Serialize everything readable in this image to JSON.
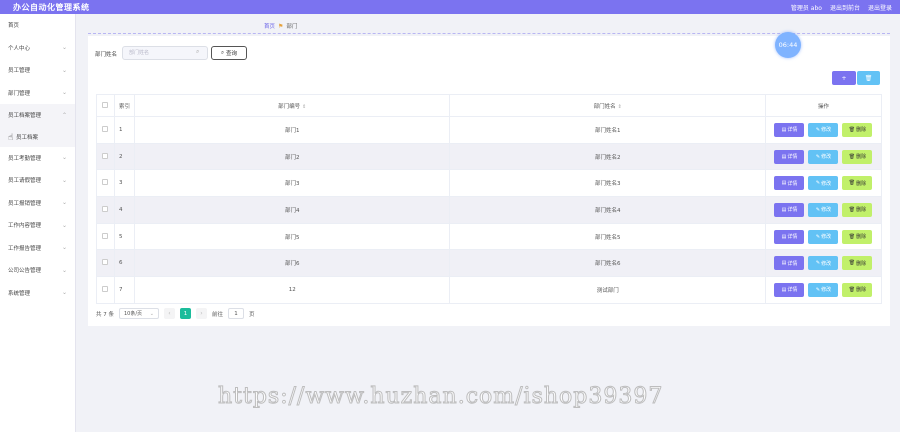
{
  "header": {
    "title": "办公自动化管理系统",
    "links": [
      "管理员 abo",
      "退出到前台",
      "退出登录"
    ]
  },
  "sidebar": {
    "items": [
      {
        "label": "首页",
        "arrow": false
      },
      {
        "label": "个人中心",
        "arrow": true
      },
      {
        "label": "员工管理",
        "arrow": true
      },
      {
        "label": "部门管理",
        "arrow": true
      },
      {
        "label": "员工档案管理",
        "arrow": true,
        "open": true
      },
      {
        "label": "员工档案",
        "arrow": false,
        "sub": true
      },
      {
        "label": "员工考勤管理",
        "arrow": true
      },
      {
        "label": "员工请假管理",
        "arrow": true
      },
      {
        "label": "员工报销管理",
        "arrow": true
      },
      {
        "label": "工作内容管理",
        "arrow": true
      },
      {
        "label": "工作报告管理",
        "arrow": true
      },
      {
        "label": "公司公告管理",
        "arrow": true
      },
      {
        "label": "系统管理",
        "arrow": true
      }
    ]
  },
  "breadcrumb": {
    "home": "首页",
    "current": "部门"
  },
  "search": {
    "label": "部门姓名",
    "placeholder": "部门姓名",
    "button": "查询"
  },
  "clock": "06:44",
  "toolbar": {
    "add": "+",
    "delete": "🗑"
  },
  "table": {
    "headers": {
      "index": "索引",
      "code": "部门编号",
      "name": "部门姓名",
      "ops": "操作"
    },
    "rows": [
      {
        "index": "1",
        "code": "部门1",
        "name": "部门姓名1"
      },
      {
        "index": "2",
        "code": "部门2",
        "name": "部门姓名2"
      },
      {
        "index": "3",
        "code": "部门3",
        "name": "部门姓名3"
      },
      {
        "index": "4",
        "code": "部门4",
        "name": "部门姓名4"
      },
      {
        "index": "5",
        "code": "部门5",
        "name": "部门姓名5"
      },
      {
        "index": "6",
        "code": "部门6",
        "name": "部门姓名6"
      },
      {
        "index": "7",
        "code": "12",
        "name": "测试部门"
      }
    ],
    "ops": {
      "detail": "详情",
      "edit": "修改",
      "remove": "删除"
    }
  },
  "pager": {
    "total": "共 7 条",
    "page_size": "10条/页",
    "current": "1",
    "goto": "前往",
    "goto_value": "1",
    "page_unit": "页"
  },
  "watermark": "https://www.huzhan.com/ishop39397",
  "colors": {
    "primary": "#7b73f0",
    "info": "#62c2f5",
    "success": "#c1f06a",
    "pager": "#1bbc9b"
  }
}
